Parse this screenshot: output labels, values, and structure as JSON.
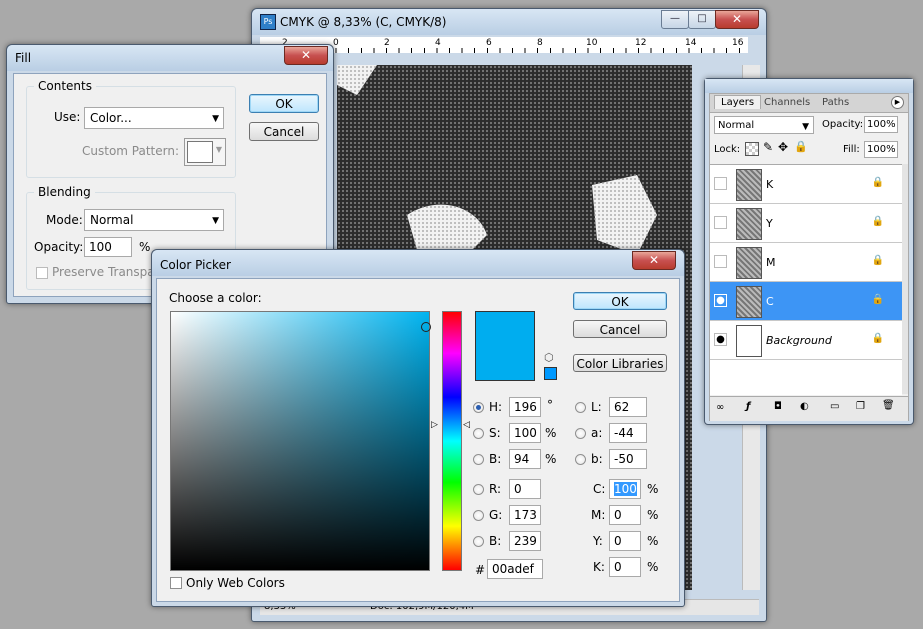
{
  "document": {
    "title": "CMYK @ 8,33% (C, CMYK/8)",
    "ruler_numbers": [
      "2",
      "0",
      "2",
      "4",
      "6",
      "8",
      "10",
      "12",
      "14",
      "16"
    ],
    "status": {
      "zoom": "8,33%",
      "doc": "Doc: 102,9M/120,4M"
    }
  },
  "fill_dialog": {
    "title": "Fill",
    "contents_label": "Contents",
    "use_label": "Use:",
    "use_value": "Color...",
    "custom_pattern_label": "Custom Pattern:",
    "blending_label": "Blending",
    "mode_label": "Mode:",
    "mode_value": "Normal",
    "opacity_label": "Opacity:",
    "opacity_value": "100",
    "opacity_unit": "%",
    "preserve_label": "Preserve Transparency",
    "ok_label": "OK",
    "cancel_label": "Cancel"
  },
  "layers_panel": {
    "tabs": [
      "Layers",
      "Channels",
      "Paths"
    ],
    "blend_mode": "Normal",
    "opacity_label": "Opacity:",
    "opacity_value": "100%",
    "lock_label": "Lock:",
    "fill_label": "Fill:",
    "fill_value": "100%",
    "layers": [
      {
        "name": "K",
        "visible": false,
        "selected": false
      },
      {
        "name": "Y",
        "visible": false,
        "selected": false
      },
      {
        "name": "M",
        "visible": false,
        "selected": false
      },
      {
        "name": "C",
        "visible": true,
        "selected": true
      },
      {
        "name": "Background",
        "visible": true,
        "selected": false
      }
    ]
  },
  "color_picker": {
    "title": "Color Picker",
    "choose_label": "Choose a color:",
    "ok_label": "OK",
    "cancel_label": "Cancel",
    "libraries_label": "Color Libraries",
    "current_color": "#00adef",
    "hsb": {
      "h": "196",
      "s": "100",
      "b": "94"
    },
    "lab": {
      "l": "62",
      "a": "-44",
      "b": "-50"
    },
    "rgb": {
      "r": "0",
      "g": "173",
      "b": "239"
    },
    "cmyk": {
      "c": "100",
      "m": "0",
      "y": "0",
      "k": "0"
    },
    "hex": "00adef",
    "labels": {
      "h": "H:",
      "s": "S:",
      "b": "B:",
      "l": "L:",
      "a": "a:",
      "lab_b": "b:",
      "r": "R:",
      "g": "G:",
      "rgb_b": "B:",
      "c": "C:",
      "m": "M:",
      "y": "Y:",
      "k": "K:",
      "hash": "#",
      "degree": "°",
      "percent": "%"
    },
    "web_only_label": "Only Web Colors"
  }
}
